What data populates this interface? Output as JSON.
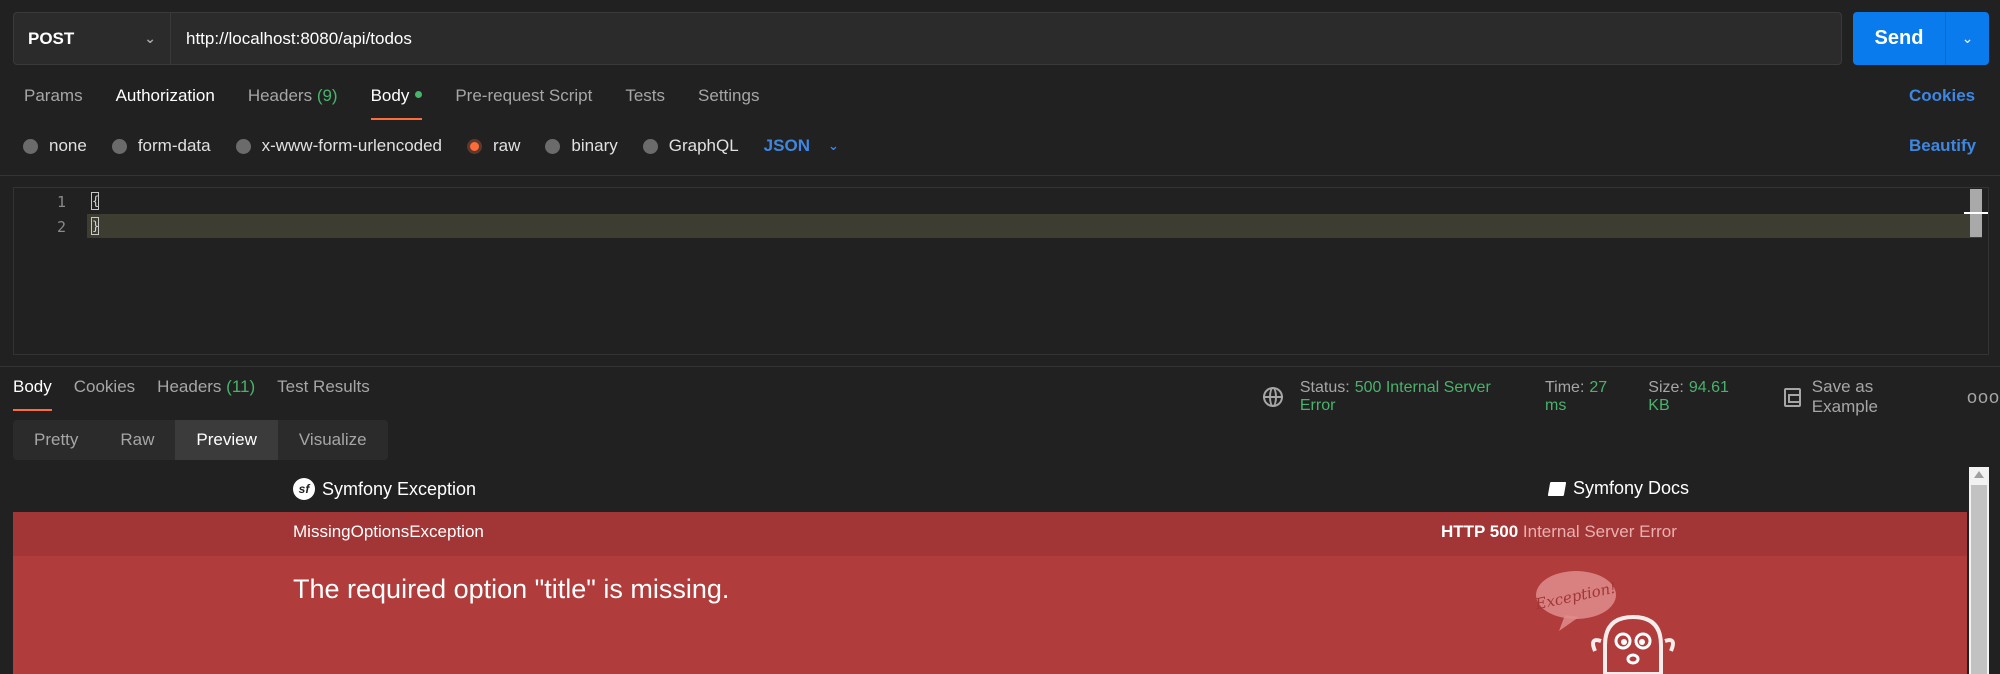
{
  "request": {
    "method": "POST",
    "url": "http://localhost:8080/api/todos",
    "send_label": "Send"
  },
  "req_tabs": {
    "params": "Params",
    "authorization": "Authorization",
    "headers": "Headers",
    "headers_count": "(9)",
    "body": "Body",
    "prerequest": "Pre-request Script",
    "tests": "Tests",
    "settings": "Settings",
    "cookies": "Cookies"
  },
  "body_types": {
    "none": "none",
    "form_data": "form-data",
    "urlencoded": "x-www-form-urlencoded",
    "raw": "raw",
    "binary": "binary",
    "graphql": "GraphQL",
    "format": "JSON",
    "selected": "raw",
    "beautify": "Beautify"
  },
  "editor": {
    "line1_num": "1",
    "line2_num": "2",
    "line1": "{",
    "line2": "}"
  },
  "response": {
    "tabs": {
      "body": "Body",
      "cookies": "Cookies",
      "headers": "Headers",
      "headers_count": "(11)",
      "test_results": "Test Results"
    },
    "status_label": "Status:",
    "status_value": "500 Internal Server Error",
    "time_label": "Time:",
    "time_value": "27 ms",
    "size_label": "Size:",
    "size_value": "94.61 KB",
    "save_example": "Save as Example",
    "more": "ooo",
    "view_tabs": {
      "pretty": "Pretty",
      "raw": "Raw",
      "preview": "Preview",
      "visualize": "Visualize"
    }
  },
  "preview": {
    "brand": "Symfony Exception",
    "logo_letter": "sf",
    "docs": "Symfony Docs",
    "exception_class": "MissingOptionsException",
    "http_label": "HTTP 500",
    "http_text": "Internal Server Error",
    "message": "The required option \"title\" is missing.",
    "ghost_bubble": "Exception!"
  },
  "colors": {
    "accent_orange": "#ff6c37",
    "link_blue": "#3e86e0",
    "send_blue": "#097bed",
    "status_green": "#49b36b",
    "error_red_dark": "#a23535",
    "error_red": "#b03c3c"
  }
}
